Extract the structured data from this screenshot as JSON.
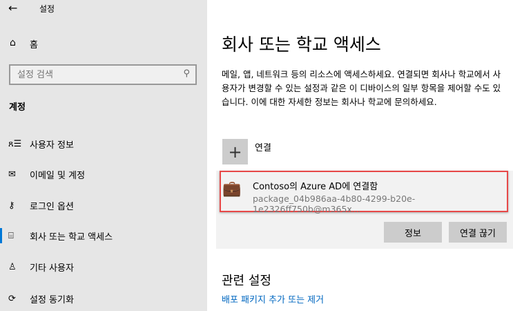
{
  "window": {
    "title": "설정",
    "back_icon": "←"
  },
  "sidebar": {
    "home": "홈",
    "search_placeholder": "설정 검색",
    "section": "계정",
    "items": [
      {
        "label": "사용자 정보",
        "icon": "person-list-icon",
        "glyph": "ጸ☰"
      },
      {
        "label": "이메일 및 계정",
        "icon": "mail-icon",
        "glyph": "✉"
      },
      {
        "label": "로그인 옵션",
        "icon": "key-icon",
        "glyph": "🔍"
      },
      {
        "label": "회사 또는 학교 액세스",
        "icon": "briefcase-icon",
        "glyph": "💼",
        "selected": true
      },
      {
        "label": "기타 사용자",
        "icon": "add-person-icon",
        "glyph": "⍝"
      },
      {
        "label": "설정 동기화",
        "icon": "sync-icon",
        "glyph": "⟳"
      }
    ]
  },
  "main": {
    "title": "회사 또는 학교 액세스",
    "description": "메일, 앱, 네트워크 등의 리소스에 액세스하세요. 연결되면 회사나 학교에서 사용자가 변경할 수 있는 설정과 같은 이 디바이스의 일부 항목을 제어할 수도 있습니다. 이에 대한 자세한 정보는 회사나 학교에 문의하세요.",
    "connect_label": "연결",
    "account": {
      "title": "Contoso의 Azure AD에 연결함",
      "subtitle": "package_04b986aa-4b80-4299-b20e-1e2326ff750b@m365x..."
    },
    "info_button": "정보",
    "disconnect_button": "연결 끊기",
    "related_title": "관련 설정",
    "related_link": "배포 패키지 추가 또는 제거"
  },
  "colors": {
    "accent": "#0078d7",
    "highlight": "#e74848",
    "link": "#0067c0"
  }
}
